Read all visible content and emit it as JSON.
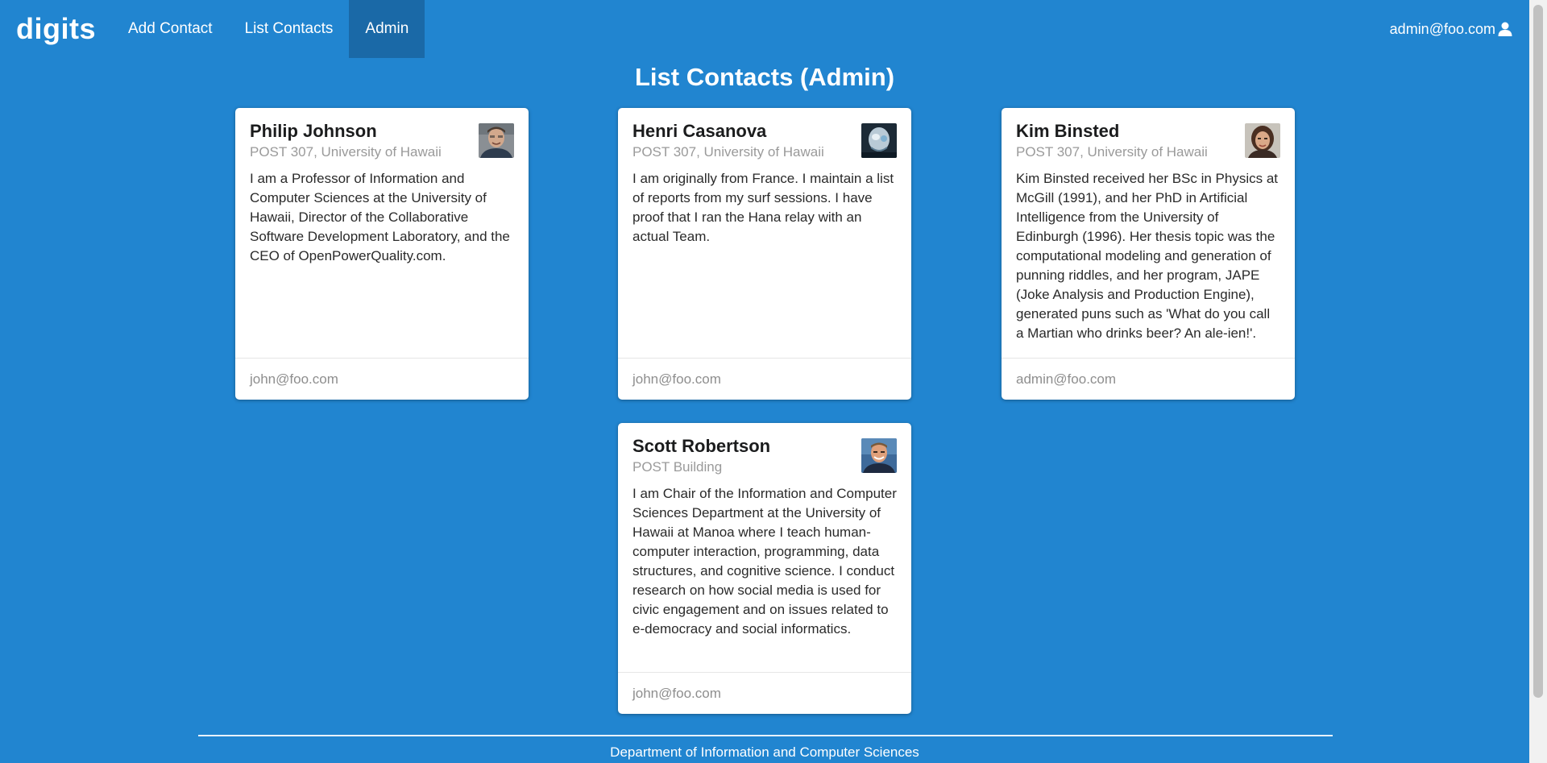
{
  "navbar": {
    "brand": "digits",
    "items": [
      {
        "label": "Add Contact"
      },
      {
        "label": "List Contacts"
      },
      {
        "label": "Admin"
      }
    ],
    "user_email": "admin@foo.com",
    "active_color": "#1a69a7"
  },
  "page": {
    "title": "List Contacts (Admin)",
    "background": "#2185d0"
  },
  "contacts": [
    {
      "name": "Philip Johnson",
      "address": "POST 307, University of Hawaii",
      "description": "I am a Professor of Information and Computer Sciences at the University of Hawaii, Director of the Collaborative Software Development Laboratory, and the CEO of OpenPowerQuality.com.",
      "owner": "john@foo.com"
    },
    {
      "name": "Henri Casanova",
      "address": "POST 307, University of Hawaii",
      "description": "I am originally from France. I maintain a list of reports from my surf sessions. I have proof that I ran the Hana relay with an actual Team.",
      "owner": "john@foo.com"
    },
    {
      "name": "Kim Binsted",
      "address": "POST 307, University of Hawaii",
      "description": "Kim Binsted received her BSc in Physics at McGill (1991), and her PhD in Artificial Intelligence from the University of Edinburgh (1996). Her thesis topic was the computational modeling and generation of punning riddles, and her program, JAPE (Joke Analysis and Production Engine), generated puns such as 'What do you call a Martian who drinks beer? An ale-ien!'.",
      "owner": "admin@foo.com"
    },
    {
      "name": "Scott Robertson",
      "address": "POST Building",
      "description": "I am Chair of the Information and Computer Sciences Department at the University of Hawaii at Manoa where I teach human-computer interaction, programming, data structures, and cognitive science. I conduct research on how social media is used for civic engagement and on issues related to e-democracy and social informatics.",
      "owner": "john@foo.com"
    }
  ],
  "footer": {
    "text": "Department of Information and Computer Sciences"
  }
}
